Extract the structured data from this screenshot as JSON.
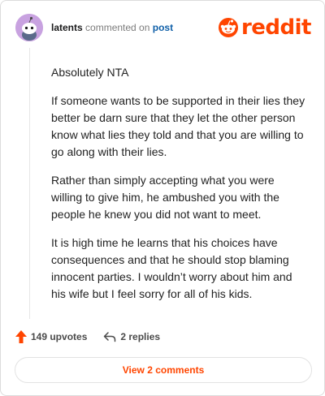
{
  "comment": {
    "author": "latents",
    "action_text": "commented on",
    "target_link": "post",
    "paragraphs": [
      "Absolutely NTA",
      "If someone wants to be supported in their lies they better be darn sure that they let the other person know what lies they told and that you are willing to go along with their lies.",
      "Rather than simply accepting what you were willing to give him, he ambushed you with the people he knew you did not want to meet.",
      "It is high time he learns that his choices have consequences and that he should stop blaming innocent parties. I wouldn’t worry about him and his wife but I feel sorry for all of his kids."
    ]
  },
  "brand": {
    "wordmark": "reddit",
    "color": "#ff4500"
  },
  "actions": {
    "upvotes_label": "149 upvotes",
    "replies_label": "2 replies"
  },
  "footer": {
    "view_comments_label": "View 2 comments"
  },
  "colors": {
    "accent": "#ff4500",
    "link": "#0f5fa8",
    "avatar_bg": "#c8a2e0"
  },
  "icons": {
    "avatar": "snoo-avatar-icon",
    "brand": "reddit-snoo-icon",
    "upvote": "upvote-arrow-icon",
    "reply": "reply-arrow-icon"
  }
}
